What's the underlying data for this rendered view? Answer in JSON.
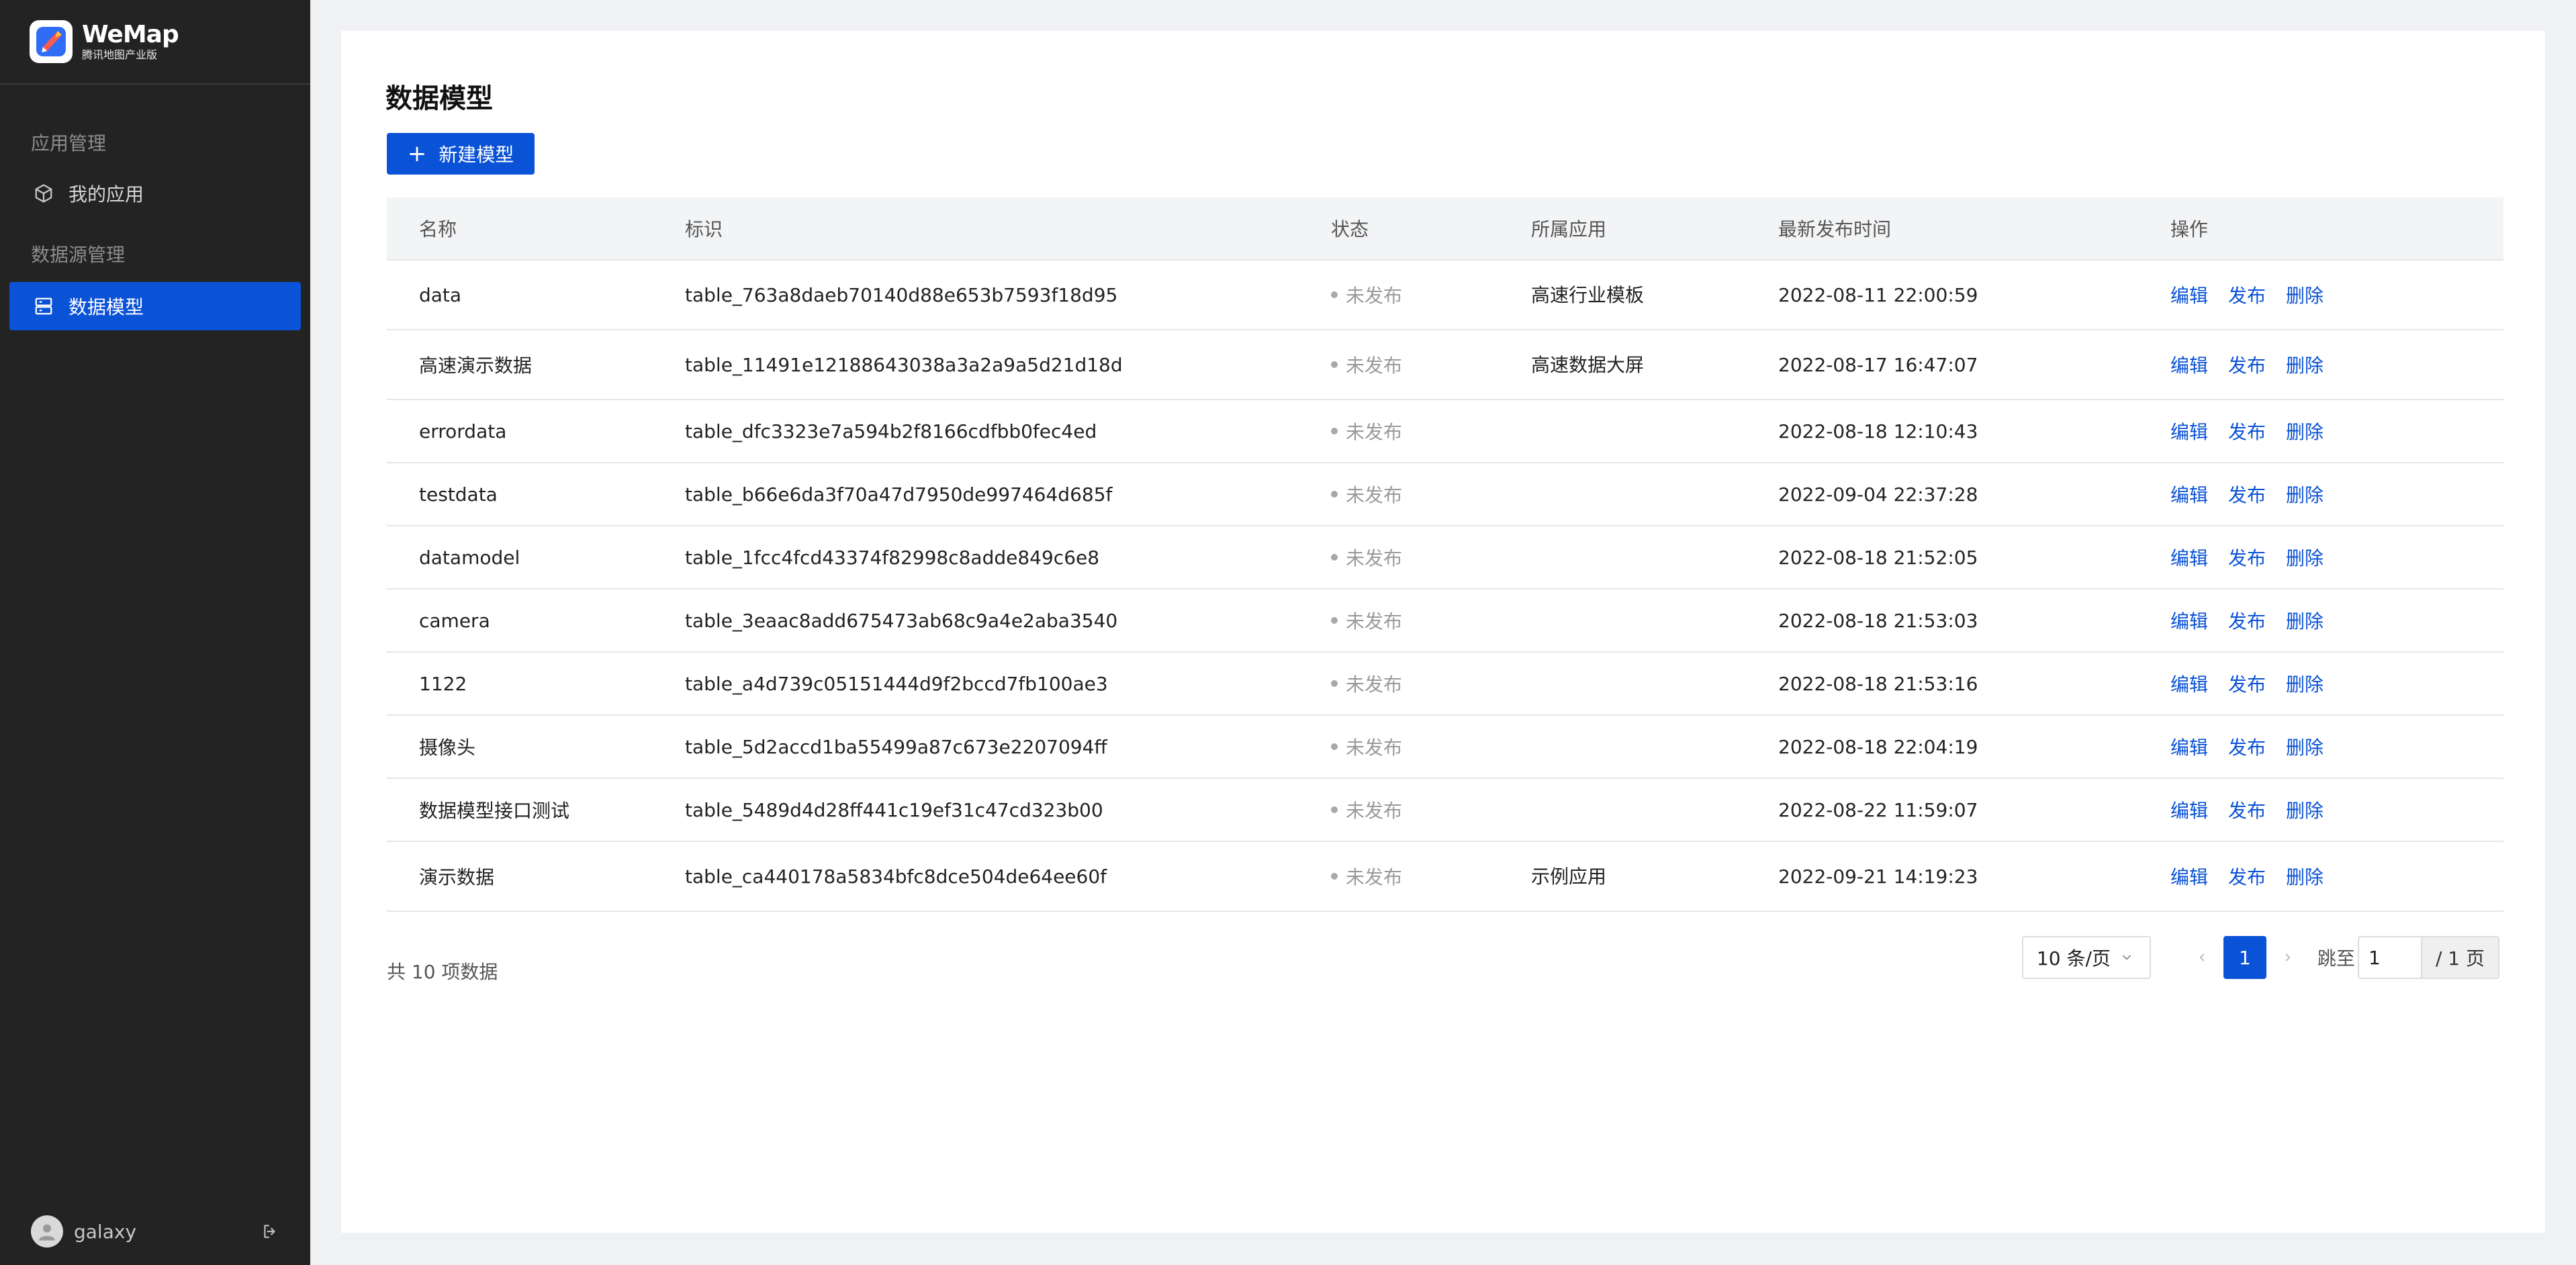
{
  "brand": {
    "name": "WeMap",
    "subtitle": "腾讯地图产业版"
  },
  "sidebar": {
    "groups": [
      {
        "title": "应用管理",
        "items": [
          {
            "label": "我的应用",
            "icon": "cube-icon"
          }
        ]
      },
      {
        "title": "数据源管理",
        "items": [
          {
            "label": "数据模型",
            "icon": "database-icon",
            "active": true
          }
        ]
      }
    ],
    "user": {
      "name": "galaxy"
    }
  },
  "page": {
    "title": "数据模型",
    "new_button": "新建模型"
  },
  "table": {
    "columns": [
      "名称",
      "标识",
      "状态",
      "所属应用",
      "最新发布时间",
      "操作"
    ],
    "op_labels": {
      "edit": "编辑",
      "publish": "发布",
      "delete": "删除"
    },
    "rows": [
      {
        "name": "data",
        "id": "table_763a8daeb70140d88e653b7593f18d95",
        "status": "未发布",
        "app": "高速行业模板",
        "time": "2022-08-11 22:00:59"
      },
      {
        "name": "高速演示数据",
        "id": "table_11491e12188643038a3a2a9a5d21d18d",
        "status": "未发布",
        "app": "高速数据大屏",
        "time": "2022-08-17 16:47:07"
      },
      {
        "name": "errordata",
        "id": "table_dfc3323e7a594b2f8166cdfbb0fec4ed",
        "status": "未发布",
        "app": "",
        "time": "2022-08-18 12:10:43"
      },
      {
        "name": "testdata",
        "id": "table_b66e6da3f70a47d7950de997464d685f",
        "status": "未发布",
        "app": "",
        "time": "2022-09-04 22:37:28"
      },
      {
        "name": "datamodel",
        "id": "table_1fcc4fcd43374f82998c8adde849c6e8",
        "status": "未发布",
        "app": "",
        "time": "2022-08-18 21:52:05"
      },
      {
        "name": "camera",
        "id": "table_3eaac8add675473ab68c9a4e2aba3540",
        "status": "未发布",
        "app": "",
        "time": "2022-08-18 21:53:03"
      },
      {
        "name": "1122",
        "id": "table_a4d739c05151444d9f2bccd7fb100ae3",
        "status": "未发布",
        "app": "",
        "time": "2022-08-18 21:53:16"
      },
      {
        "name": "摄像头",
        "id": "table_5d2accd1ba55499a87c673e2207094ff",
        "status": "未发布",
        "app": "",
        "time": "2022-08-18 22:04:19"
      },
      {
        "name": "数据模型接口测试",
        "id": "table_5489d4d28ff441c19ef31c47cd323b00",
        "status": "未发布",
        "app": "",
        "time": "2022-08-22 11:59:07"
      },
      {
        "name": "演示数据",
        "id": "table_ca440178a5834bfc8dce504de64ee60f",
        "status": "未发布",
        "app": "示例应用",
        "time": "2022-09-21 14:19:23"
      }
    ]
  },
  "pagination": {
    "total_text": "共 10 项数据",
    "page_size": "10 条/页",
    "current_page": "1",
    "jump_label": "跳至",
    "jump_value": "1",
    "total_pages": "/ 1 页"
  },
  "colors": {
    "primary": "#0a52d6",
    "sidebar_bg": "#232323",
    "page_bg": "#f0f1f3"
  }
}
